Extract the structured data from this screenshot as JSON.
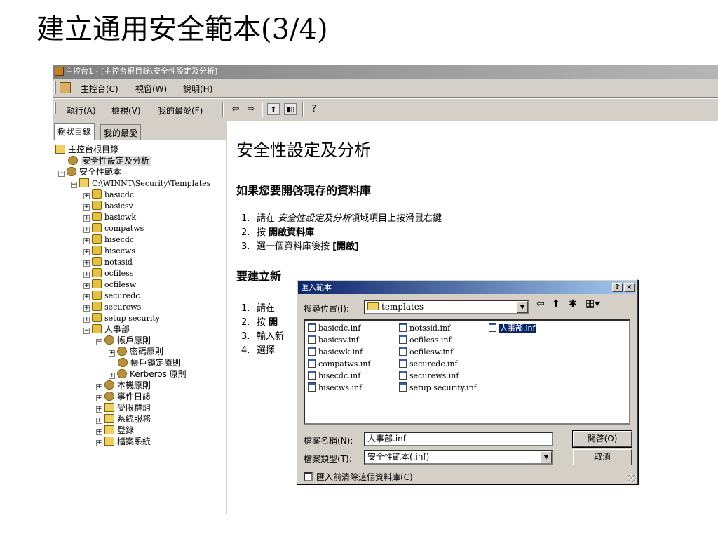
{
  "slide_title": "建立通用安全範本(3/4)",
  "window": {
    "title": "主控台1 - [主控台根目錄\\安全性設定及分析]"
  },
  "menubar": {
    "items": [
      "主控台(C)",
      "視窗(W)",
      "說明(H)"
    ]
  },
  "toolbar": {
    "items": [
      "執行(A)",
      "檢視(V)",
      "我的最愛(F)"
    ],
    "buttons": [
      "back-arrow",
      "forward-arrow",
      "up-level",
      "show-hide-tree",
      "help"
    ]
  },
  "tabs": [
    "樹狀目錄",
    "我的最愛"
  ],
  "tree": {
    "root": "主控台根目錄",
    "analysis": "安全性設定及分析",
    "templates_node": "安全性範本",
    "templates_path": "C:\\WINNT\\Security\\Templates",
    "templates": [
      "basicdc",
      "basicsv",
      "basicwk",
      "compatws",
      "hisecdc",
      "hisecws",
      "notssid",
      "ocfiless",
      "ocfilesw",
      "securedc",
      "securews",
      "setup security"
    ],
    "custom": "人事部",
    "account_policy": "帳戶原則",
    "account_children": [
      "密碼原則",
      "帳戶鎖定原則",
      "Kerberos 原則"
    ],
    "other_policies": [
      "本機原則",
      "事件日誌",
      "受限群組",
      "系統服務",
      "登錄",
      "檔案系統"
    ]
  },
  "content": {
    "heading": "安全性設定及分析",
    "section1_title": "如果您要開啓現存的資料庫",
    "steps1": [
      {
        "num": "1.",
        "pre": "請在",
        "em": "安全性設定及分析",
        "post": "領域項目上按滑鼠右鍵"
      },
      {
        "num": "2.",
        "pre": "按",
        "bold": "開啟資料庫"
      },
      {
        "num": "3.",
        "pre": "選一個資料庫後按",
        "bold": "[開啟]"
      }
    ],
    "section2_title": "要建立新",
    "steps2": [
      {
        "num": "1.",
        "pre": "請在"
      },
      {
        "num": "2.",
        "pre": "按",
        "bold": "開"
      },
      {
        "num": "3.",
        "pre": "輸入新"
      },
      {
        "num": "4.",
        "pre": "選擇"
      }
    ]
  },
  "dialog": {
    "title": "匯入範本",
    "help_btn": "?",
    "close_btn": "×",
    "lookin_label": "搜尋位置(I):",
    "lookin_value": "templates",
    "files": [
      "basicdc.inf",
      "basicsv.inf",
      "basicwk.inf",
      "compatws.inf",
      "hisecdc.inf",
      "hisecws.inf",
      "notssid.inf",
      "ocfiless.inf",
      "ocfilesw.inf",
      "securedc.inf",
      "securews.inf",
      "setup security.inf",
      "人事部.inf"
    ],
    "selected_file": "人事部.inf",
    "filename_label": "檔案名稱(N):",
    "filename_value": "人事部.inf",
    "filetype_label": "檔案類型(T):",
    "filetype_value": "安全性範本(.inf)",
    "open_btn": "開啓(O)",
    "cancel_btn": "取消",
    "clear_db_checkbox": "匯入前清除這個資料庫(C)",
    "clear_db_checked": false
  }
}
